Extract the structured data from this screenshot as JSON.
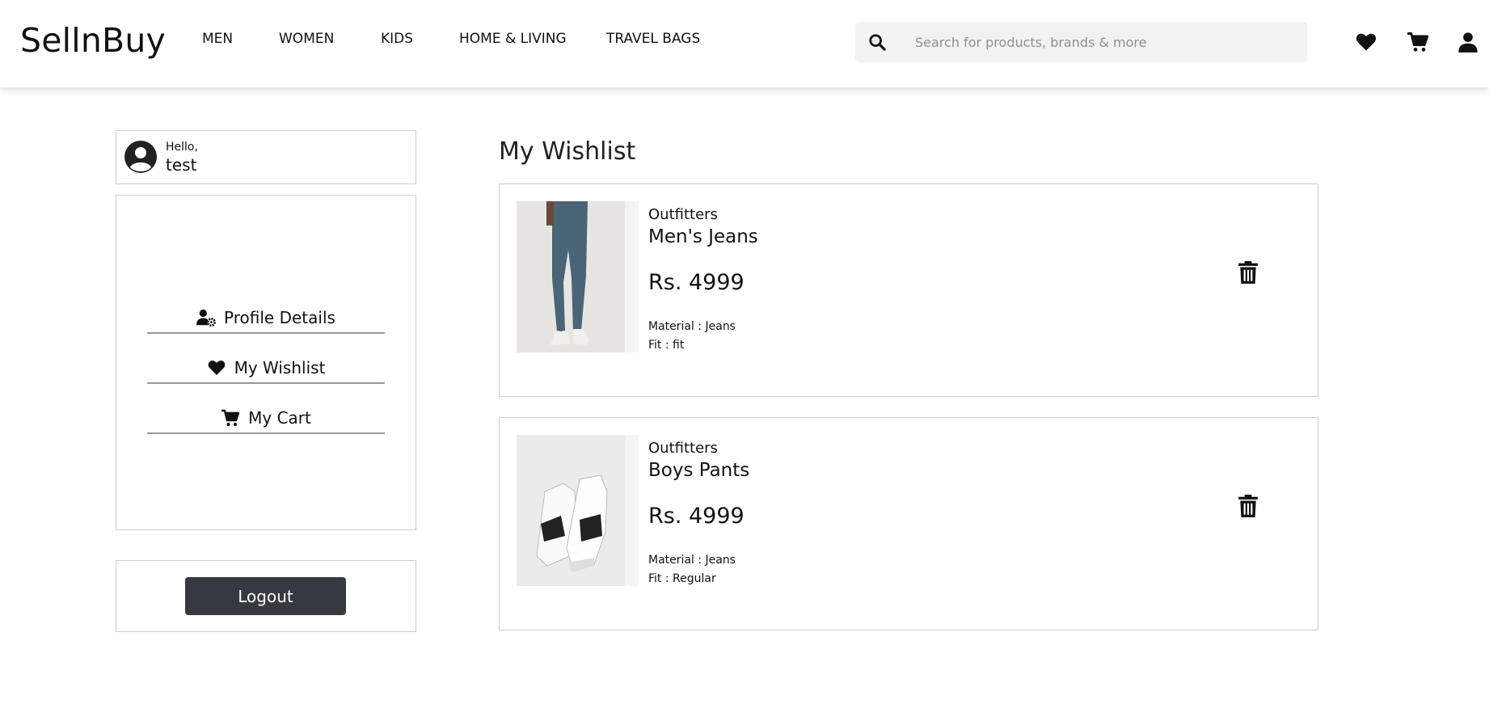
{
  "header": {
    "logo": "SellnBuy",
    "nav": [
      "MEN",
      "WOMEN",
      "KIDS",
      "HOME & LIVING",
      "TRAVEL BAGS"
    ],
    "search_placeholder": "Search for products, brands & more",
    "icons": [
      "heart-icon",
      "cart-icon",
      "user-icon"
    ]
  },
  "sidebar": {
    "greeting": "Hello,",
    "username": "test",
    "menu": [
      "Profile Details",
      "My Wishlist",
      "My Cart"
    ],
    "logout_label": "Logout"
  },
  "main": {
    "title": "My Wishlist",
    "items": [
      {
        "brand": "Outfitters",
        "name": "Men's Jeans",
        "price": "Rs. 4999",
        "material": "Material : Jeans",
        "fit": "Fit : fit"
      },
      {
        "brand": "Outfitters",
        "name": "Boys Pants",
        "price": "Rs. 4999",
        "material": "Material : Jeans",
        "fit": "Fit : Regular"
      }
    ]
  },
  "colors": {
    "logout_bg": "#353a41",
    "search_bg": "#f2f2f2",
    "border": "#cfcfcf"
  }
}
